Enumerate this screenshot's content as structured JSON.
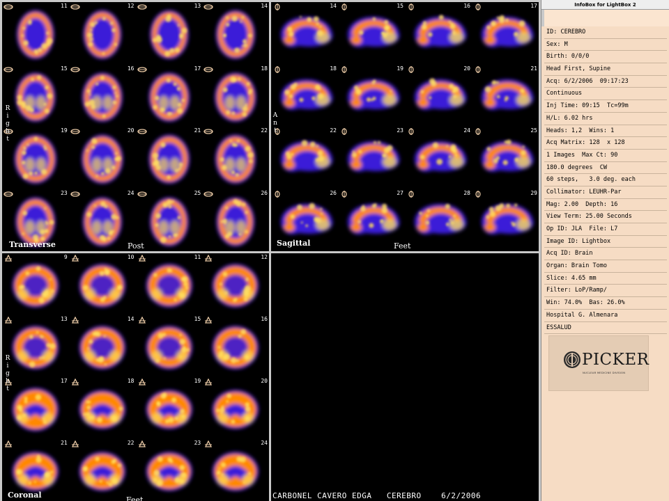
{
  "window": {
    "infobox_title": "InfoBox for LightBox 2"
  },
  "transverse": {
    "label": "Transverse",
    "bottom_label": "Post",
    "side_label": "Right",
    "slices": [
      "11",
      "12",
      "13",
      "14",
      "15",
      "16",
      "17",
      "18",
      "19",
      "20",
      "21",
      "22",
      "23",
      "24",
      "25",
      "26"
    ]
  },
  "sagittal": {
    "label": "Sagittal",
    "bottom_label": "Feet",
    "side_label": "Ant",
    "slices": [
      "14",
      "15",
      "16",
      "17",
      "18",
      "19",
      "20",
      "21",
      "22",
      "23",
      "24",
      "25",
      "26",
      "27",
      "28",
      "29"
    ]
  },
  "coronal": {
    "label": "Coronal",
    "bottom_label": "Feet",
    "side_label": "Right",
    "slices": [
      "9",
      "10",
      "11",
      "12",
      "13",
      "14",
      "15",
      "16",
      "17",
      "18",
      "19",
      "20",
      "21",
      "22",
      "23",
      "24"
    ]
  },
  "patient_line": "CARBONEL CAVERO EDGA   CEREBRO    6/2/2006",
  "info": {
    "rows": [
      "ID: CEREBRO",
      "Sex: M",
      "Birth: 0/0/0",
      "Head First, Supine",
      "Acq: 6/2/2006  09:17:23",
      "Continuous",
      "Inj Time: 09:15  Tc=99m",
      "H/L: 6.02 hrs",
      "Heads: 1,2  Wins: 1",
      "Acq Matrix: 128  x 128",
      "1 Images  Max Ct: 90",
      "180.0 degrees  CW",
      "60 steps,   3.0 deg. each",
      "Collimator: LEUHR-Par",
      "Mag: 2.00  Depth: 16",
      "View Term: 25.00 Seconds",
      "Op ID: JLA  File: L7",
      "Image ID: Lightbox",
      "Acq ID: Brain",
      "Organ: Brain Tomo",
      "Slice: 4.65 mm",
      "Filter: LoP/Ramp/",
      "Win: 74.0%  Bas: 26.0%",
      "Hospital G. Almenara",
      "ESSALUD"
    ],
    "logo": {
      "name": "PICKER",
      "subtitle": "NUCLEAR MEDICINE DIVISION"
    }
  },
  "colors": {
    "background": "#000000",
    "infobox_bg": "#f6dcc4",
    "scan_high": "#ffe060",
    "scan_mid": "#ff8800",
    "scan_low": "#3a1ad8"
  }
}
